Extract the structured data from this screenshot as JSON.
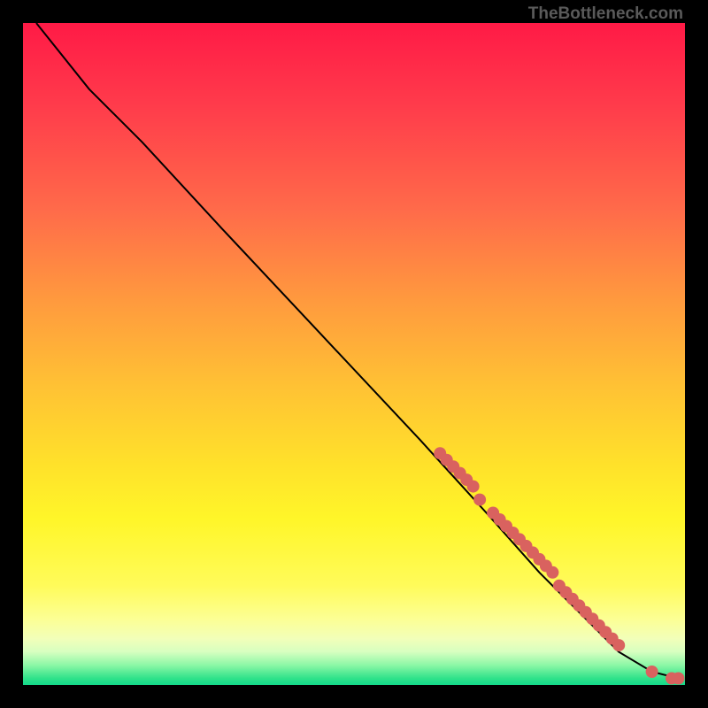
{
  "attribution": "TheBottleneck.com",
  "chart_data": {
    "type": "line",
    "title": "",
    "xlabel": "",
    "ylabel": "",
    "xlim": [
      0,
      100
    ],
    "ylim": [
      0,
      100
    ],
    "curve": [
      {
        "x": 2,
        "y": 100
      },
      {
        "x": 10,
        "y": 90
      },
      {
        "x": 18,
        "y": 82
      },
      {
        "x": 30,
        "y": 69
      },
      {
        "x": 45,
        "y": 53
      },
      {
        "x": 60,
        "y": 37
      },
      {
        "x": 70,
        "y": 26
      },
      {
        "x": 78,
        "y": 17
      },
      {
        "x": 84,
        "y": 11
      },
      {
        "x": 90,
        "y": 5
      },
      {
        "x": 95,
        "y": 2
      },
      {
        "x": 99,
        "y": 1
      }
    ],
    "series": [
      {
        "name": "points",
        "color": "#d9625f",
        "values": [
          {
            "x": 63,
            "y": 35
          },
          {
            "x": 64,
            "y": 34
          },
          {
            "x": 65,
            "y": 33
          },
          {
            "x": 66,
            "y": 32
          },
          {
            "x": 67,
            "y": 31
          },
          {
            "x": 68,
            "y": 30
          },
          {
            "x": 69,
            "y": 28
          },
          {
            "x": 71,
            "y": 26
          },
          {
            "x": 72,
            "y": 25
          },
          {
            "x": 73,
            "y": 24
          },
          {
            "x": 74,
            "y": 23
          },
          {
            "x": 75,
            "y": 22
          },
          {
            "x": 76,
            "y": 21
          },
          {
            "x": 77,
            "y": 20
          },
          {
            "x": 78,
            "y": 19
          },
          {
            "x": 79,
            "y": 18
          },
          {
            "x": 80,
            "y": 17
          },
          {
            "x": 81,
            "y": 15
          },
          {
            "x": 82,
            "y": 14
          },
          {
            "x": 83,
            "y": 13
          },
          {
            "x": 84,
            "y": 12
          },
          {
            "x": 85,
            "y": 11
          },
          {
            "x": 86,
            "y": 10
          },
          {
            "x": 87,
            "y": 9
          },
          {
            "x": 88,
            "y": 8
          },
          {
            "x": 89,
            "y": 7
          },
          {
            "x": 90,
            "y": 6
          },
          {
            "x": 95,
            "y": 2
          },
          {
            "x": 98,
            "y": 1
          },
          {
            "x": 99,
            "y": 1
          }
        ]
      }
    ]
  }
}
